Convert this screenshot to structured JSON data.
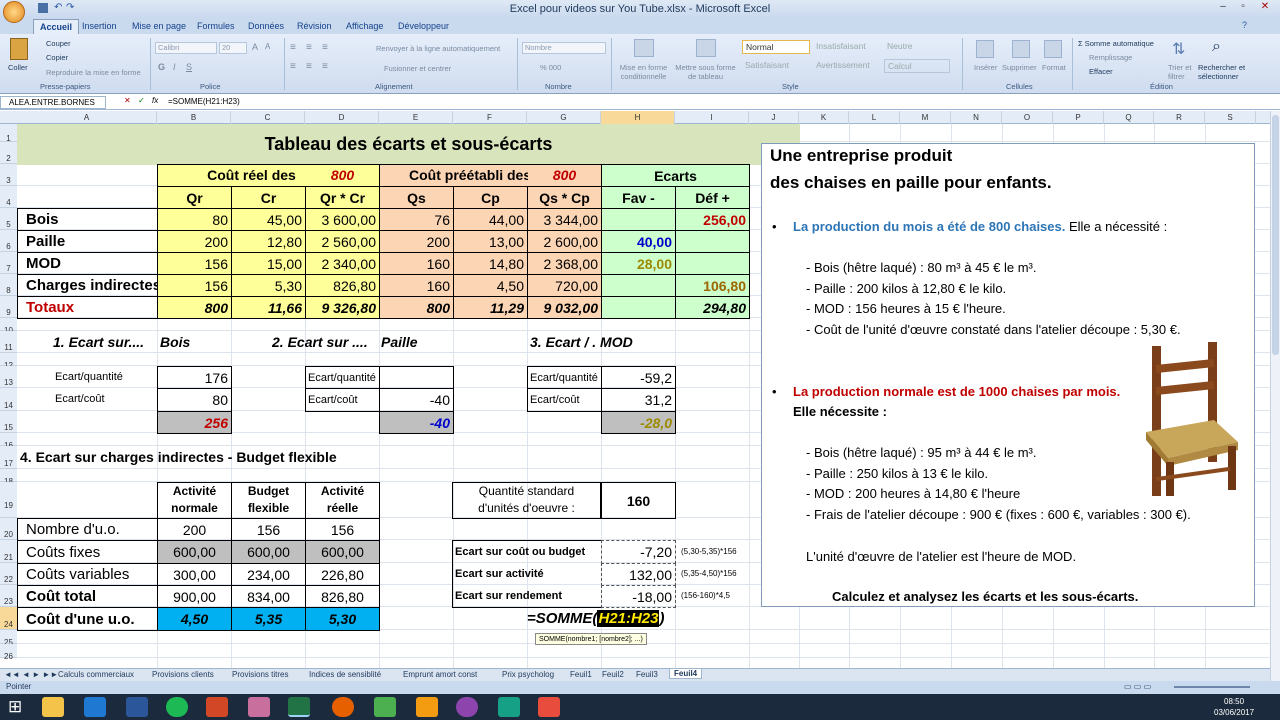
{
  "window": {
    "title": "Excel pour videos sur You Tube.xlsx - Microsoft Excel"
  },
  "ribbon_tabs": [
    "Accueil",
    "Insertion",
    "Mise en page",
    "Formules",
    "Données",
    "Révision",
    "Affichage",
    "Développeur"
  ],
  "ribbon": {
    "coller": "Coller",
    "couper": "Couper",
    "copier": "Copier",
    "reproduire": "Reproduire la mise en forme",
    "presse_papiers": "Presse-papiers",
    "font_name": "Calibri",
    "font_size": "20",
    "police": "Police",
    "renvoyer": "Renvoyer à la ligne automatiquement",
    "fusionner": "Fusionner et centrer",
    "alignement": "Alignement",
    "number_format": "Nombre",
    "nombre": "Nombre",
    "mfc": "Mise en forme conditionnelle",
    "mft": "Mettre sous forme de tableau",
    "styles": [
      "Normal",
      "Insatisfaisant",
      "Neutre",
      "Satisfaisant",
      "Avertissement",
      "Calcul"
    ],
    "style": "Style",
    "inserer": "Insérer",
    "supprimer": "Supprimer",
    "format": "Format",
    "cellules": "Cellules",
    "somme_auto": "Somme automatique",
    "remplissage": "Remplissage",
    "effacer": "Effacer",
    "trier": "Trier et filtrer",
    "rechercher": "Rechercher et sélectionner",
    "edition": "Édition"
  },
  "formula_bar": {
    "name_box": "ALEA.ENTRE.BORNES",
    "formula": "=SOMME(H21:H23)"
  },
  "columns": [
    "A",
    "B",
    "C",
    "D",
    "E",
    "F",
    "G",
    "H",
    "I",
    "J",
    "K",
    "L",
    "M",
    "N",
    "O",
    "P",
    "Q",
    "R",
    "S"
  ],
  "rows": [
    "1",
    "2",
    "3",
    "4",
    "5",
    "6",
    "7",
    "8",
    "9",
    "10",
    "11",
    "12",
    "13",
    "14",
    "15",
    "16",
    "17",
    "18",
    "19",
    "20",
    "21",
    "22",
    "23",
    "24",
    "25",
    "26"
  ],
  "sheet": {
    "title": "Tableau des écarts et sous-écarts",
    "hdr_cout_reel": "Coût réel des",
    "hdr_800a": "800",
    "hdr_cout_pre": "Coût préétabli des",
    "hdr_800b": "800",
    "hdr_ecarts": "Ecarts",
    "sub": [
      "Qr",
      "Cr",
      "Qr * Cr",
      "Qs",
      "Cp",
      "Qs * Cp",
      "Fav -",
      "Déf +"
    ],
    "main_rows": [
      {
        "label": "Bois",
        "v": [
          "80",
          "45,00",
          "3 600,00",
          "76",
          "44,00",
          "3 344,00",
          "",
          "256,00"
        ]
      },
      {
        "label": "Paille",
        "v": [
          "200",
          "12,80",
          "2 560,00",
          "200",
          "13,00",
          "2 600,00",
          "40,00",
          ""
        ]
      },
      {
        "label": "MOD",
        "v": [
          "156",
          "15,00",
          "2 340,00",
          "160",
          "14,80",
          "2 368,00",
          "28,00",
          ""
        ]
      },
      {
        "label": "Charges indirectes",
        "v": [
          "156",
          "5,30",
          "826,80",
          "160",
          "4,50",
          "720,00",
          "",
          "106,80"
        ]
      },
      {
        "label": "Totaux",
        "v": [
          "800",
          "11,66",
          "9 326,80",
          "800",
          "11,29",
          "9 032,00",
          "",
          "294,80"
        ]
      }
    ],
    "e1_title": "1. Ecart sur....",
    "e1_name": "Bois",
    "e2_title": "2. Ecart sur ....",
    "e2_name": "Paille",
    "e3_title": "3. Ecart / . MOD",
    "eq": "Ecart/quantité",
    "ec": "Ecart/coût",
    "e1": [
      "176",
      "80",
      "256"
    ],
    "e2": [
      "",
      "-40",
      "-40"
    ],
    "e3": [
      "-59,2",
      "31,2",
      "-28,0"
    ],
    "s4_title": "4. Ecart sur charges indirectes - Budget flexible",
    "bf_hdr": [
      "Activité normale",
      "Budget flexible",
      "Activité réelle"
    ],
    "bf_rows": [
      {
        "label": "Nombre d'u.o.",
        "v": [
          "200",
          "156",
          "156"
        ]
      },
      {
        "label": "Coûts fixes",
        "v": [
          "600,00",
          "600,00",
          "600,00"
        ]
      },
      {
        "label": "Coûts variables",
        "v": [
          "300,00",
          "234,00",
          "226,80"
        ]
      },
      {
        "label": "Coût total",
        "v": [
          "900,00",
          "834,00",
          "826,80"
        ]
      },
      {
        "label": "Coût d'une u.o.",
        "v": [
          "4,50",
          "5,35",
          "5,30"
        ]
      }
    ],
    "qs_label": "Quantité standard d'unités d'oeuvre :",
    "qs_value": "160",
    "ec_rows": [
      {
        "label": "Ecart sur coût ou budget",
        "v": "-7,20",
        "n": "(5,30-5,35)*156"
      },
      {
        "label": "Ecart sur activité",
        "v": "132,00",
        "n": "(5,35-4,50)*156"
      },
      {
        "label": "Ecart sur rendement",
        "v": "-18,00",
        "n": "(156-160)*4,5"
      }
    ],
    "edit_formula_prefix": "=SOMME(",
    "edit_formula_ref": "H21:H23",
    "edit_formula_suffix": ")",
    "tooltip": "SOMME(nombre1; [nombre2]; ...)"
  },
  "textbox": {
    "line1": "Une entreprise produit",
    "line2": "des chaises en paille pour enfants.",
    "b1_blue": "La production du mois a été de 800 chaises.",
    "b1_rest": " Elle a nécessité :",
    "b1_items": [
      "- Bois (hêtre laqué) : 80 m³ à 45 € le m³.",
      "- Paille : 200 kilos à 12,80 € le kilo.",
      "- MOD : 156 heures à 15 € l'heure.",
      "- Coût de l'unité d'œuvre constaté dans l'atelier découpe : 5,30 €."
    ],
    "b2_red": "La production normale est de 1000 chaises par mois.",
    "b2_line2": "Elle nécessite :",
    "b2_items": [
      "- Bois (hêtre laqué) : 95 m³ à 44 € le m³.",
      "- Paille : 250 kilos à 13 € le kilo.",
      "- MOD : 200 heures à 14,80 € l'heure",
      "- Frais de l'atelier découpe : 900 € (fixes : 600 €, variables : 300 €)."
    ],
    "uo": "L'unité d'œuvre de l'atelier est l'heure de MOD.",
    "task": "Calculez et analysez les écarts et les sous-écarts."
  },
  "sheet_tabs": [
    "Calculs commerciaux",
    "Provisions clients",
    "Provisions titres",
    "Indices de sensiblité",
    "Emprunt amort const",
    "Prix psycholog",
    "Feuil1",
    "Feuil2",
    "Feuil3",
    "Feuil4"
  ],
  "status": {
    "mode": "Pointer"
  },
  "clock": {
    "time": "08:50",
    "date": "03/06/2017"
  }
}
